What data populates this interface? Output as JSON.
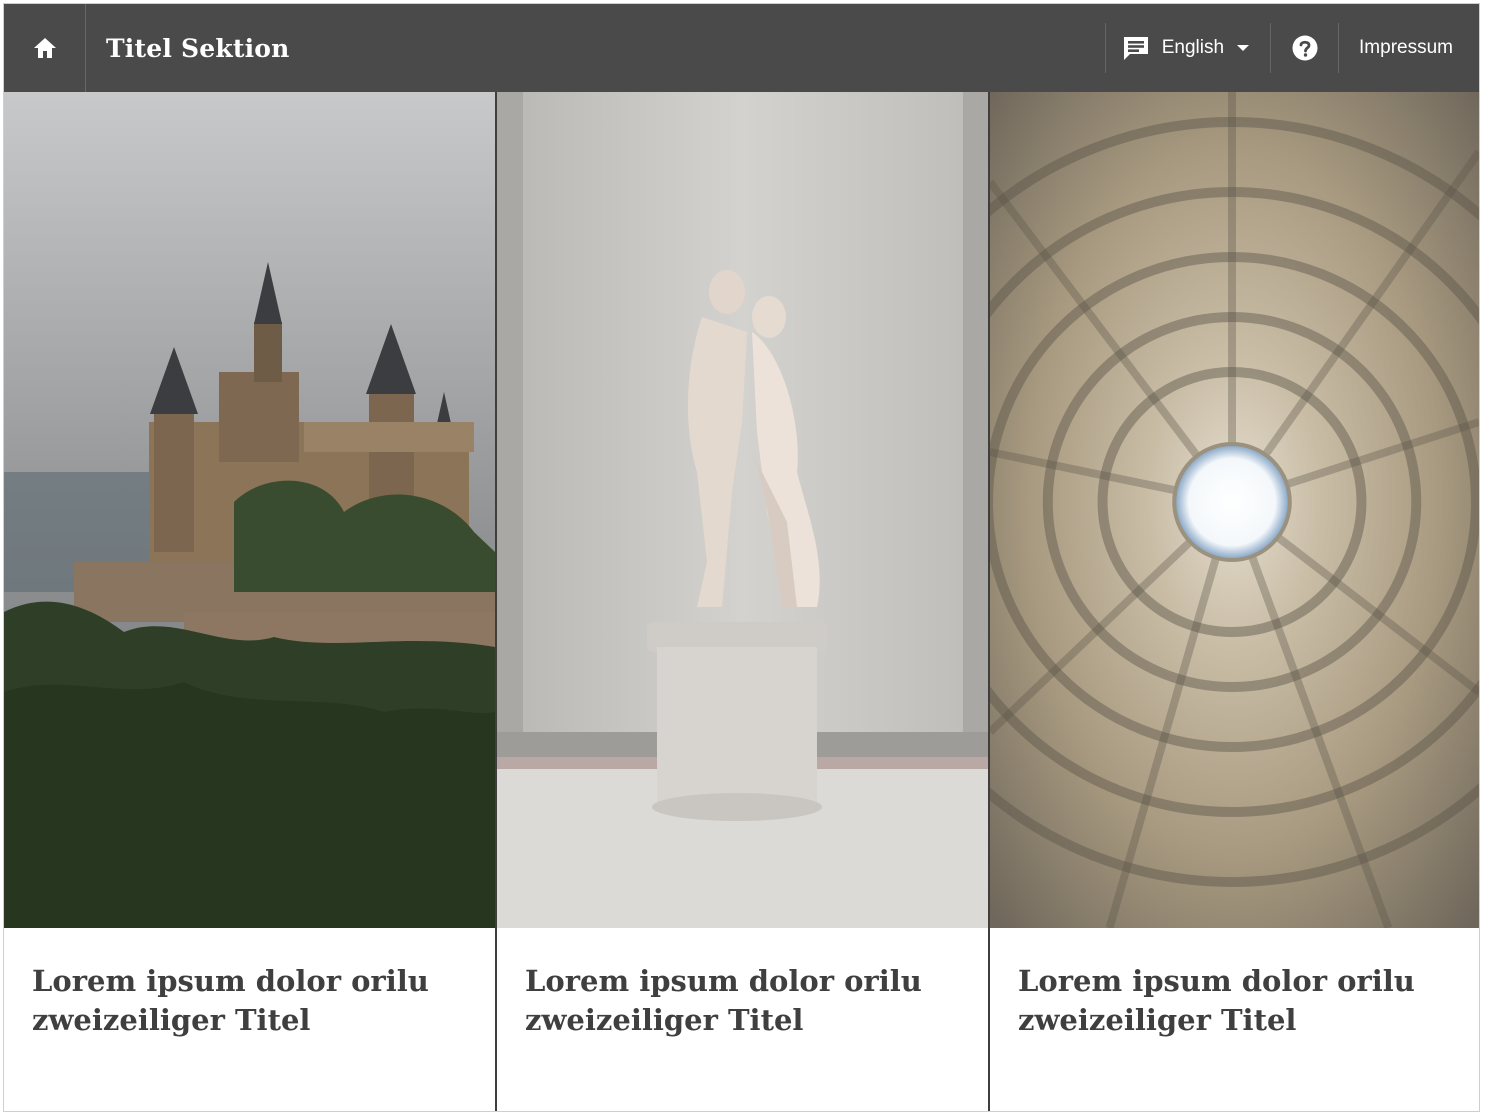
{
  "topbar": {
    "home_icon": "home-icon",
    "section_title": "Titel Sektion",
    "language": {
      "icon": "chat-icon",
      "selected": "English",
      "dropdown_icon": "caret-down-icon"
    },
    "help_icon": "help-circle-icon",
    "impressum": "Impressum"
  },
  "cards": [
    {
      "image": "castle-on-forested-hill",
      "title_line1": "Lorem ipsum dolor orilu",
      "title_line2": "zweizeiliger Titel"
    },
    {
      "image": "marble-statue-couple",
      "title_line1": "Lorem ipsum dolor orilu",
      "title_line2": "zweizeiliger Titel"
    },
    {
      "image": "pantheon-dome-oculus",
      "title_line1": "Lorem ipsum dolor orilu",
      "title_line2": "zweizeiliger Titel"
    }
  ],
  "colors": {
    "topbar_bg": "#4a4a4a",
    "title_text": "#3f3f3f",
    "divider": "#3e3e3e"
  }
}
